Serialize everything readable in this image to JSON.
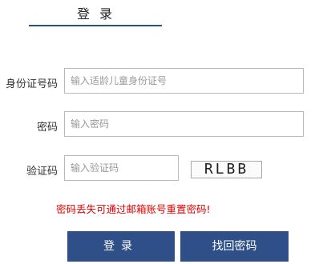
{
  "header": {
    "tab_title": "登录"
  },
  "form": {
    "id_label": "身份证号码",
    "id_placeholder": "输入适龄儿童身份证号",
    "password_label": "密码",
    "password_placeholder": "输入密码",
    "captcha_label": "验证码",
    "captcha_placeholder": "输入验证码",
    "captcha_text": "RLBB"
  },
  "messages": {
    "password_lost": "密码丢失可通过邮箱账号重置密码!"
  },
  "buttons": {
    "login": "登录",
    "recover": "找回密码"
  },
  "colors": {
    "accent": "#2e4f87",
    "error": "#e00000"
  }
}
